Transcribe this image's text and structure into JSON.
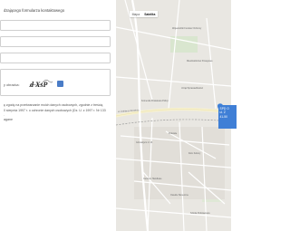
{
  "form": {
    "heading": "dzającego formularza kontaktowego",
    "captcha_label": "y obrazka:",
    "captcha_text": "d XsP",
    "consent_lines": [
      "ę zgodę na przetwarzanie moich danych osobowych, zgodnie z treścią",
      "0 sierpnia 1997 r. o ochronie danych osobowych (Dz. U. z 1997 r. Nr 133",
      "."
    ],
    "required_note": "agane"
  },
  "map": {
    "tabs": [
      {
        "label": "Mapa",
        "active": false
      },
      {
        "label": "Satelita",
        "active": true
      }
    ],
    "info_lines": [
      "SPD O",
      "ul. Ż",
      "41-50"
    ],
    "labels": {
      "poi_a": "Wojewódzki Fundusz Ochrony",
      "poi_b": "Mieszkalnictwo Postępowe",
      "poi_c": "Urząd Sprawiedliwości",
      "poi_d": "Komenda Powiatowa Policji",
      "poi_e": "Gimnazjum nr 13",
      "poi_f": "Dom Kultury",
      "poi_g": "Centrum Handlowe",
      "poi_h": "Osiedle Słoneczne",
      "poi_i": "Szkoła Podstawowa",
      "road_a": "ul. Żołnierzy Września",
      "road_b": "Podwale"
    },
    "marker_color": "#3b7fd8"
  },
  "colors": {
    "accent": "#4a7cc7"
  }
}
